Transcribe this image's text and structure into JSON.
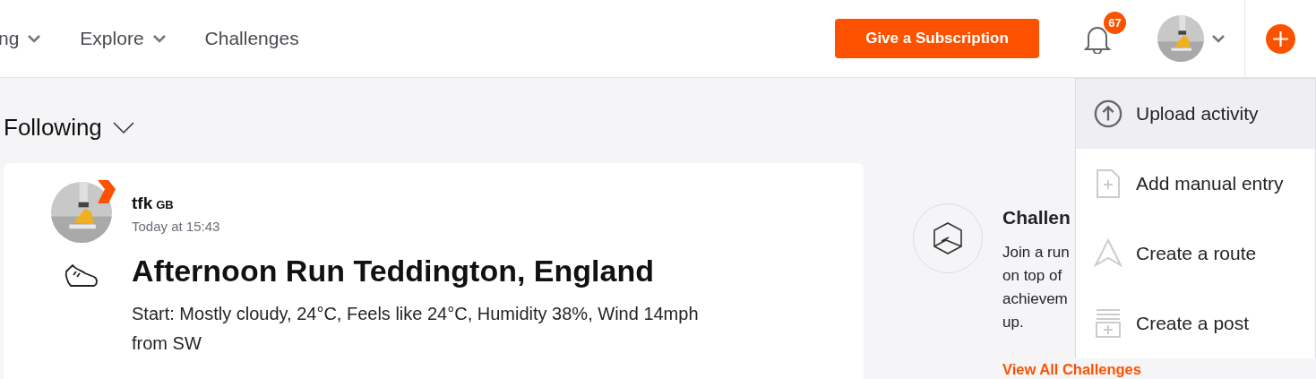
{
  "nav": {
    "items": [
      {
        "label": "ng",
        "dropdown": true
      },
      {
        "label": "Explore",
        "dropdown": true
      },
      {
        "label": "Challenges",
        "dropdown": false
      }
    ],
    "cta": "Give a Subscription",
    "notifications": "67"
  },
  "feed_filter": "Following",
  "activity": {
    "athlete": "tfk",
    "country": "GB",
    "time": "Today at 15:43",
    "title": "Afternoon Run Teddington, England",
    "description": "Start: Mostly cloudy, 24°C, Feels like 24°C, Humidity 38%, Wind 14mph from SW"
  },
  "challenges": {
    "title": "Challen",
    "lines": [
      "Join a run",
      "on top of",
      "achievem",
      "up."
    ],
    "link": "View All Challenges"
  },
  "menu": [
    {
      "kind": "upload",
      "label": "Upload activity",
      "selected": true
    },
    {
      "kind": "manual",
      "label": "Add manual entry",
      "selected": false
    },
    {
      "kind": "route",
      "label": "Create a route",
      "selected": false
    },
    {
      "kind": "post",
      "label": "Create a post",
      "selected": false
    }
  ]
}
